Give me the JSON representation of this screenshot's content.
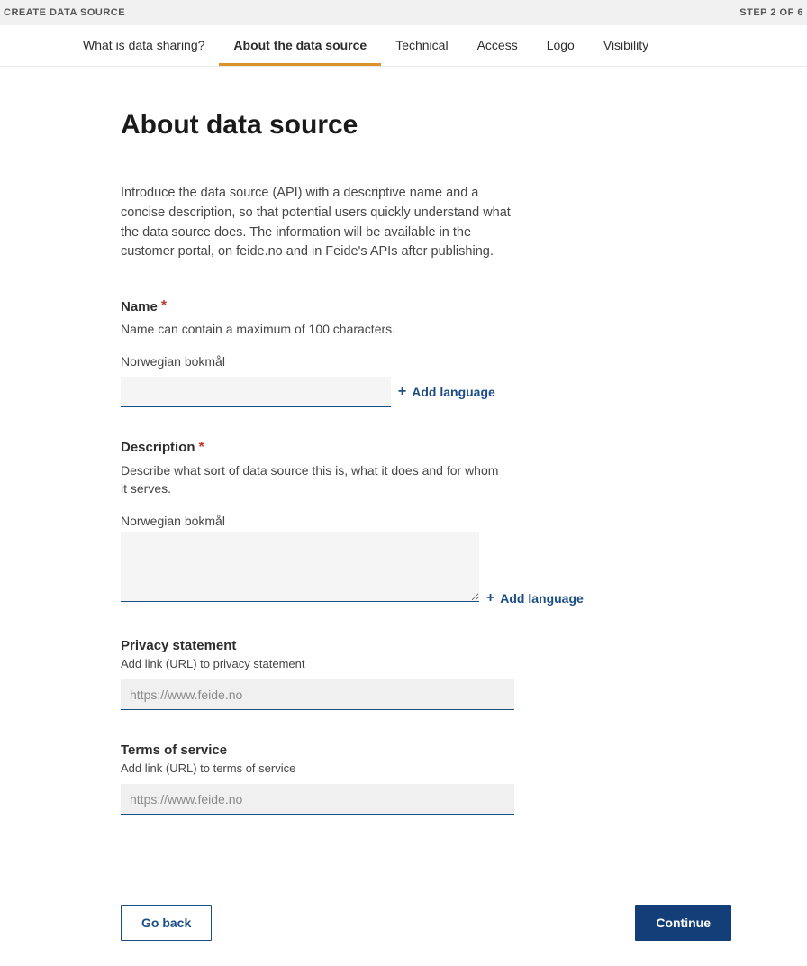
{
  "topbar": {
    "title": "CREATE DATA SOURCE",
    "step": "STEP 2 OF 6"
  },
  "tabs": [
    {
      "label": "What is data sharing?"
    },
    {
      "label": "About the data source"
    },
    {
      "label": "Technical"
    },
    {
      "label": "Access"
    },
    {
      "label": "Logo"
    },
    {
      "label": "Visibility"
    }
  ],
  "page": {
    "heading": "About data source",
    "intro": "Introduce the data source (API) with a descriptive name and a concise description, so that potential users quickly understand what the data source does. The information will be available in the customer portal, on feide.no and in Feide's APIs after publishing."
  },
  "name_section": {
    "label": "Name",
    "required_marker": "*",
    "hint": "Name can contain a maximum of 100 characters.",
    "lang": "Norwegian bokmål",
    "add_language": "Add language"
  },
  "description_section": {
    "label": "Description",
    "required_marker": "*",
    "hint": "Describe what sort of data source this is, what it does and for whom it serves.",
    "lang": "Norwegian bokmål",
    "add_language": "Add language"
  },
  "privacy_section": {
    "label": "Privacy statement",
    "hint": "Add link (URL) to privacy statement",
    "placeholder": "https://www.feide.no"
  },
  "tos_section": {
    "label": "Terms of service",
    "hint": "Add link (URL) to terms of service",
    "placeholder": "https://www.feide.no"
  },
  "buttons": {
    "back": "Go back",
    "continue": "Continue"
  }
}
